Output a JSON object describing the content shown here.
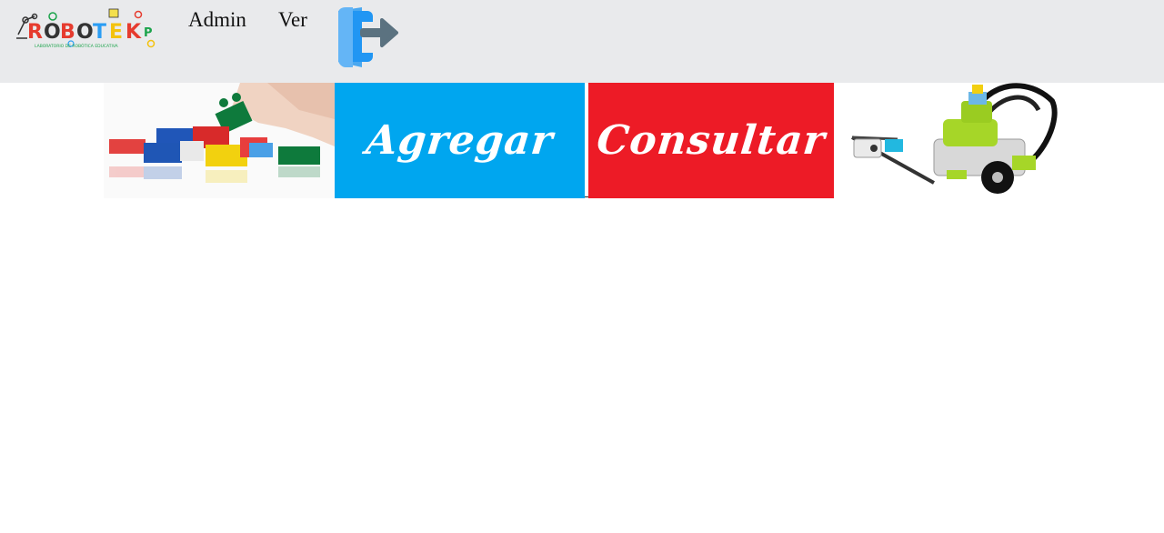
{
  "header": {
    "logo_text": "ROBOTEKP",
    "logo_subtitle": "LABORATORIO DE ROBÓTICA EDUCATIVA",
    "nav": [
      {
        "label": "Admin"
      },
      {
        "label": "Ver"
      }
    ],
    "logout_icon": "door-exit-icon"
  },
  "banners": {
    "agregar_label": "Agregar",
    "consultar_label": "Consultar"
  },
  "colors": {
    "topbar": "#e9eaec",
    "agregar": "#00a6ef",
    "consultar": "#ed1b26"
  }
}
